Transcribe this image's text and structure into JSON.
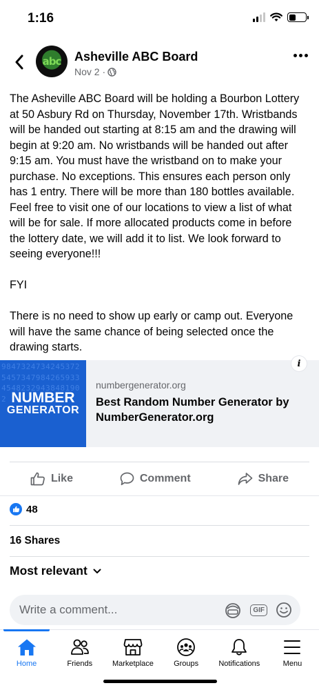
{
  "status_bar": {
    "time": "1:16"
  },
  "post": {
    "page_name": "Asheville ABC Board",
    "avatar_text": "abc",
    "date": "Nov 2 ·",
    "body": "The Asheville ABC Board will be holding a Bourbon Lottery at 50 Asbury Rd on Thursday, November 17th. Wristbands will be handed out starting at 8:15 am and the drawing will begin at 9:20 am.  No wristbands will be handed out after 9:15 am.  You must have the wristband on to make your purchase.  No exceptions.  This ensures each person only has 1 entry.  There will be more than 180 bottles available.  Feel free to visit one of our locations to view a list of what will be for sale. If more allocated products come in before the lottery date, we will add it to list. We look forward to seeing everyone!!!\n\nFYI\n\nThere is no need to show up early or camp out. Everyone will have the same chance of being selected once the drawing starts."
  },
  "link_card": {
    "thumb_line1": "NUMBER",
    "thumb_line2": "GENERATOR",
    "thumb_digits": "9847324734245372545734798426593345482329438481902",
    "domain": "numbergenerator.org",
    "title": "Best Random Number Generator by NumberGenerator.org",
    "info_label": "i"
  },
  "actions": {
    "like": "Like",
    "comment": "Comment",
    "share": "Share"
  },
  "reactions": {
    "count": "48"
  },
  "shares": "16 Shares",
  "sort_label": "Most relevant",
  "comment_box": {
    "placeholder": "Write a comment..."
  },
  "tabs": [
    {
      "label": "Home",
      "icon": "home-icon",
      "active": true
    },
    {
      "label": "Friends",
      "icon": "friends-icon"
    },
    {
      "label": "Marketplace",
      "icon": "marketplace-icon"
    },
    {
      "label": "Groups",
      "icon": "groups-icon"
    },
    {
      "label": "Notifications",
      "icon": "bell-icon"
    },
    {
      "label": "Menu",
      "icon": "menu-icon"
    }
  ],
  "colors": {
    "accent": "#1877f2",
    "secondary_text": "#65676b",
    "card_bg": "#f0f2f5",
    "thumb_bg": "#1a60d0"
  }
}
